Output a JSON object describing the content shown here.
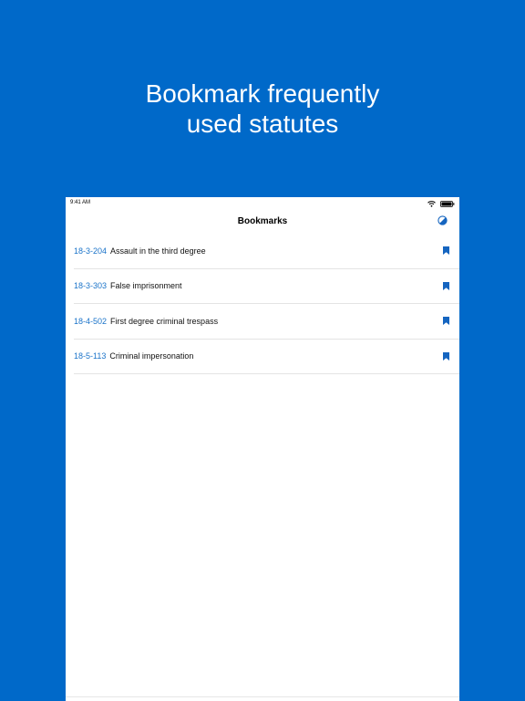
{
  "headline": {
    "line1": "Bookmark frequently",
    "line2": "used statutes"
  },
  "colors": {
    "background": "#0069c9",
    "accent": "#1a73c9",
    "bookmark": "#1565c0"
  },
  "status_bar": {
    "time": "9:41 AM"
  },
  "nav": {
    "title": "Bookmarks"
  },
  "bookmarks": [
    {
      "code": "18-3-204",
      "title": "Assault in the third degree"
    },
    {
      "code": "18-3-303",
      "title": "False imprisonment"
    },
    {
      "code": "18-4-502",
      "title": "First degree criminal trespass"
    },
    {
      "code": "18-5-113",
      "title": "Criminal impersonation"
    }
  ]
}
